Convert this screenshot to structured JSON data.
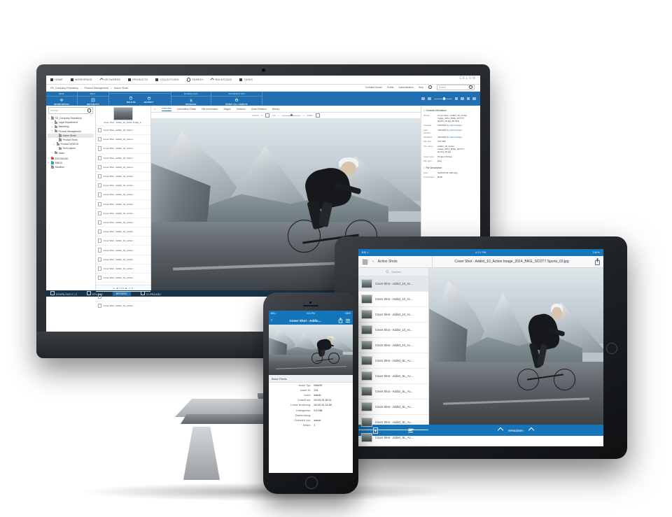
{
  "desktop": {
    "logo": "CELUM",
    "menu": [
      {
        "label": "HOME",
        "icon": "monitor-icon"
      },
      {
        "label": "WORKSPACE",
        "icon": "folder-icon"
      },
      {
        "label": "KEYWORDS",
        "icon": "tag-icon"
      },
      {
        "label": "PRODUCTS",
        "icon": "folder-icon"
      },
      {
        "label": "COLLECTIONS",
        "icon": "folder-icon"
      },
      {
        "label": "SEARCH",
        "icon": "search-icon"
      },
      {
        "label": "BACKSTAGE",
        "icon": "pin-icon"
      },
      {
        "label": "TASKS",
        "icon": "clipboard-icon"
      }
    ],
    "user": {
      "name": "Christina Muner",
      "profile": "Profile",
      "administration": "Administration",
      "help": "Help",
      "power_icon": "power-icon"
    },
    "search": {
      "placeholder": "Search",
      "icon": "search-icon"
    },
    "breadcrumb": [
      "SS_Company Repository",
      "Product Management",
      "Action Shots"
    ],
    "ribbon": {
      "groups": [
        {
          "title": "NEW",
          "items": [
            {
              "label": "Workspace",
              "icon": "plus-icon"
            }
          ]
        },
        {
          "title": "EDIT",
          "items": [
            {
              "label": "Metadata",
              "icon": "edit-icon"
            }
          ]
        },
        {
          "title": "",
          "items": [
            {
              "label": "Delete",
              "icon": "trash-icon"
            },
            {
              "label": "Basket",
              "icon": "basket-icon"
            }
          ]
        },
        {
          "title": "DOWNLOAD",
          "items": [
            {
              "label": "Original",
              "icon": "download-icon"
            }
          ]
        },
        {
          "title": "INFORMATION",
          "items": [
            {
              "label": "Print all Assets",
              "icon": "printer-icon"
            }
          ]
        }
      ]
    },
    "lookup": {
      "placeholder": "Lookup",
      "icon": "search-icon"
    },
    "tree": [
      {
        "label": "SS_Company Repository",
        "depth": 0,
        "arrow": "v",
        "color": "grey"
      },
      {
        "label": "Legal Department",
        "depth": 1,
        "arrow": ">",
        "color": "grey"
      },
      {
        "label": "Marketing",
        "depth": 1,
        "arrow": ">",
        "color": "grey"
      },
      {
        "label": "Product Management",
        "depth": 1,
        "arrow": "v",
        "color": "grey"
      },
      {
        "label": "Action Shots",
        "depth": 2,
        "arrow": "",
        "color": "grey",
        "selected": true
      },
      {
        "label": "Product Shots",
        "depth": 2,
        "arrow": "",
        "color": "grey"
      },
      {
        "label": "Product VIDEOS",
        "depth": 2,
        "arrow": ">",
        "color": "grey"
      },
      {
        "label": "Tech papers",
        "depth": 2,
        "arrow": "",
        "color": "grey"
      },
      {
        "label": "Sales",
        "depth": 1,
        "arrow": ">",
        "color": "grey"
      },
      {
        "label": "EXCHANGE",
        "depth": 0,
        "arrow": ">",
        "color": "red"
      },
      {
        "label": "INBOX",
        "depth": 0,
        "arrow": ">",
        "color": "teal"
      },
      {
        "label": "Sandbox",
        "depth": 0,
        "arrow": "",
        "color": "grey"
      }
    ],
    "list": {
      "selected_caption": "Cover Shot - Addict_10_Action Image_2...",
      "rows": [
        "Cover Shot - Addict_10_Action ...",
        "Cover Shot - Addict_10_Action ...",
        "Cover Shot - Addict_10_Action ...",
        "Cover Shot - Addict_10_Action ...",
        "Cover Shot - Addict_10_Action ...",
        "Cover Shot - Addict_SL_Action ...",
        "Cover Shot - Addict_SL_Action ...",
        "Cover Shot - Addict_SL_Action ...",
        "Cover Shot - Addict_SL_Action ...",
        "Cover Shot - Addict_SL_Action ...",
        "Cover Shot - Addict_SL_Action ...",
        "Cover Shot - Addict_SL_Action ...",
        "Cover Shot - Addict_SL_Action ...",
        "Cover Shot - Addict_SL_Action ...",
        "Cover Shot - Addict_SL_Action ...",
        "Cover Shot - Addict_SL_Action ...",
        "Cover Shot - Addict_SL_Action ...",
        "Cover Shot - Addict_SL_Action ...",
        "Cover Shot - Addict_SL_Action ...",
        "Cover Shot - Addict_SL_Action ..."
      ],
      "pager": "1 of 9"
    },
    "tabs": [
      "Overview",
      "Information Fields",
      "File Information",
      "Stages",
      "Versions",
      "Asset Relation",
      "History"
    ],
    "active_tab": "Overview",
    "viewbar": {
      "version": "current",
      "fit_label": "1:1",
      "zoom": "100%",
      "fullscreen_icon": "fullscreen-icon"
    },
    "details": {
      "general_title": "General Information",
      "general": [
        {
          "key": "Name:",
          "value": "Cover Shot - Addict_10_Action Image_2014_BIKE_SCOTT Sports_03.jpg (ID:241)"
        },
        {
          "key": "Created:",
          "value": "3/3/2015 by ",
          "link": "Administrator"
        },
        {
          "key": "Last version:",
          "value": "3/3/2015 by ",
          "link": "Administrator"
        },
        {
          "key": "Modified:",
          "value": "3/4/2015 by ",
          "link": "Administrator"
        },
        {
          "key": "File size:",
          "value": "9,51 MB"
        },
        {
          "key": "File name:",
          "value": "Addict_10_Action Image_2014_BIKE_SCOTT Sports_03.jpg"
        },
        {
          "key": "Asset type:",
          "value": "Product Picture"
        },
        {
          "key": "File type:",
          "value": "jpeg"
        }
      ],
      "description_title": "File Description",
      "description": [
        {
          "key": "Size:",
          "value": "5616x3744 (300 dpi)"
        },
        {
          "key": "Colorspace:",
          "value": "RGB"
        }
      ]
    },
    "status": [
      {
        "label": "DOWNLOAD 0 | 0",
        "icon": "download-icon",
        "active": false
      },
      {
        "label": "UPLOAD",
        "icon": "upload-icon",
        "active": false
      },
      {
        "label": "BROWSE",
        "icon": "",
        "active": true
      },
      {
        "label": "CLIPBOARD",
        "icon": "clipboard-icon",
        "active": false
      }
    ]
  },
  "ipad": {
    "status": {
      "carrier": "BELL",
      "time": "4:21 PM",
      "battery": "100%"
    },
    "nav": {
      "list_icon": "list-icon",
      "back_icon": "chevron-left-icon",
      "back_label": "Action Shots",
      "title": "Cover Shot - Addict_10_Action Image_2014_BIKE_SCOTT Sports_03.jpg",
      "share_icon": "share-icon"
    },
    "search_placeholder": "Suchen",
    "rows": [
      "Cover Shot - Addict_10_Ac...",
      "Cover Shot - Addict_10_Ac...",
      "Cover Shot - Addict_10_Ac...",
      "Cover Shot - Addict_10_Ac...",
      "Cover Shot - Addict_10_Ac...",
      "Cover Shot - Addict_SL_Ac...",
      "Cover Shot - Addict_SL_Ac...",
      "Cover Shot - Addict_SL_Ac...",
      "Cover Shot - Addict_SL_Ac...",
      "Cover Shot - Addict_SL_Ac...",
      "Cover Shot - Addict_SL_Ac..."
    ],
    "toolbar": {
      "doc_icon": "document-add-icon",
      "list_icon": "list-detail-icon",
      "metadata_label": "Metadaten"
    }
  },
  "iphone": {
    "status": {
      "carrier": "BELL",
      "time": "4:21 PM",
      "battery": "100%"
    },
    "nav": {
      "back_icon": "chevron-left-icon",
      "title": "Cover Shot - Addic...",
      "share_icon": "share-icon",
      "list_icon": "list-icon"
    },
    "fields_title": "Basic Fields",
    "fields": [
      {
        "key": "Asset Typ:",
        "value": "IMAGE"
      },
      {
        "key": "Asset ID:",
        "value": "241"
      },
      {
        "key": "Autor:",
        "value": "admin"
      },
      {
        "key": "Erstellt am:",
        "value": "03.03.15 16:21"
      },
      {
        "key": "Letzte Änderung:",
        "value": "04.03.15 14:48"
      },
      {
        "key": "Dateigrösse:",
        "value": "9,5 MB"
      },
      {
        "key": "Dateiendung:",
        "value": ""
      },
      {
        "key": "Geändert von:",
        "value": "admin"
      },
      {
        "key": "Seiten:",
        "value": "1"
      }
    ]
  },
  "colors": {
    "brand_blue": "#1f6fb2",
    "ios_blue": "#1475bb",
    "status_bar": "#17344a"
  }
}
